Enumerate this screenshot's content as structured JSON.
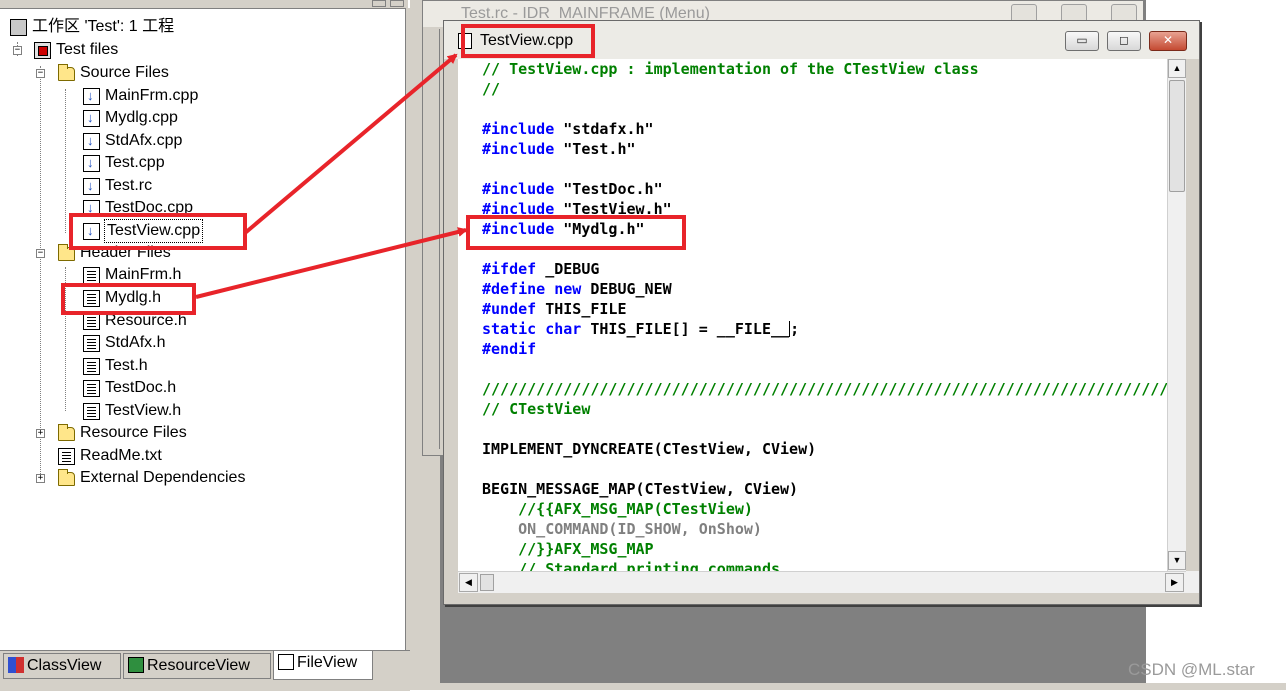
{
  "workspace": {
    "root_label": "工作区 'Test': 1 工程",
    "project_label": "Test files",
    "source_folder": "Source Files",
    "source_items": [
      "MainFrm.cpp",
      "Mydlg.cpp",
      "StdAfx.cpp",
      "Test.cpp",
      "Test.rc",
      "TestDoc.cpp",
      "TestView.cpp"
    ],
    "header_folder": "Header Files",
    "header_items": [
      "MainFrm.h",
      "Mydlg.h",
      "Resource.h",
      "StdAfx.h",
      "Test.h",
      "TestDoc.h",
      "TestView.h"
    ],
    "resource_folder": "Resource Files",
    "readme": "ReadMe.txt",
    "external_folder": "External Dependencies",
    "tabs": [
      "ClassView",
      "ResourceView",
      "FileView"
    ],
    "active_tab": "FileView"
  },
  "background_window": {
    "title": "Test.rc - IDR_MAINFRAME (Menu)"
  },
  "editor": {
    "title": "TestView.cpp",
    "minimize_glyph": "▭",
    "restore_glyph": "◻",
    "close_glyph": "✕",
    "lines": [
      {
        "t": "// TestView.cpp : implementation of the CTestView class",
        "c": "cmt"
      },
      {
        "t": "//",
        "c": "cmt"
      },
      {
        "t": "",
        "c": ""
      },
      {
        "k": "#include",
        "t": " \"stdafx.h\"",
        "c": "inc"
      },
      {
        "k": "#include",
        "t": " \"Test.h\"",
        "c": "inc"
      },
      {
        "t": "",
        "c": ""
      },
      {
        "k": "#include",
        "t": " \"TestDoc.h\"",
        "c": "inc"
      },
      {
        "k": "#include",
        "t": " \"TestView.h\"",
        "c": "inc"
      },
      {
        "k": "#include",
        "t": " \"Mydlg.h\"",
        "c": "inc"
      },
      {
        "t": "",
        "c": ""
      },
      {
        "k": "#ifdef",
        "t": " _DEBUG",
        "c": "inc"
      },
      {
        "k": "#define new",
        "t": " DEBUG_NEW",
        "c": "inc"
      },
      {
        "k": "#undef",
        "t": " THIS_FILE",
        "c": "inc"
      },
      {
        "k": "static char",
        "t": " THIS_FILE[] = __FILE__",
        "tail": ";",
        "c": "caret"
      },
      {
        "k": "#endif",
        "t": "",
        "c": "inc"
      },
      {
        "t": "",
        "c": ""
      },
      {
        "t": "/////////////////////////////////////////////////////////////////////////////",
        "c": "cmt"
      },
      {
        "t": "// CTestView",
        "c": "cmt"
      },
      {
        "t": "",
        "c": ""
      },
      {
        "t": "IMPLEMENT_DYNCREATE(CTestView, CView)",
        "c": "plain"
      },
      {
        "t": "",
        "c": ""
      },
      {
        "t": "BEGIN_MESSAGE_MAP(CTestView, CView)",
        "c": "plain"
      },
      {
        "t": "    //{{AFX_MSG_MAP(CTestView)",
        "c": "cmt"
      },
      {
        "t": "    ON_COMMAND(ID_SHOW, OnShow)",
        "c": "gray"
      },
      {
        "t": "    //}}AFX_MSG_MAP",
        "c": "cmt"
      },
      {
        "t": "    // Standard printing commands",
        "c": "cmt"
      }
    ]
  },
  "watermark": "CSDN @ML.star",
  "colors": {
    "annotation": "#e8242a",
    "comment": "#008000",
    "keyword": "#0000ff"
  }
}
